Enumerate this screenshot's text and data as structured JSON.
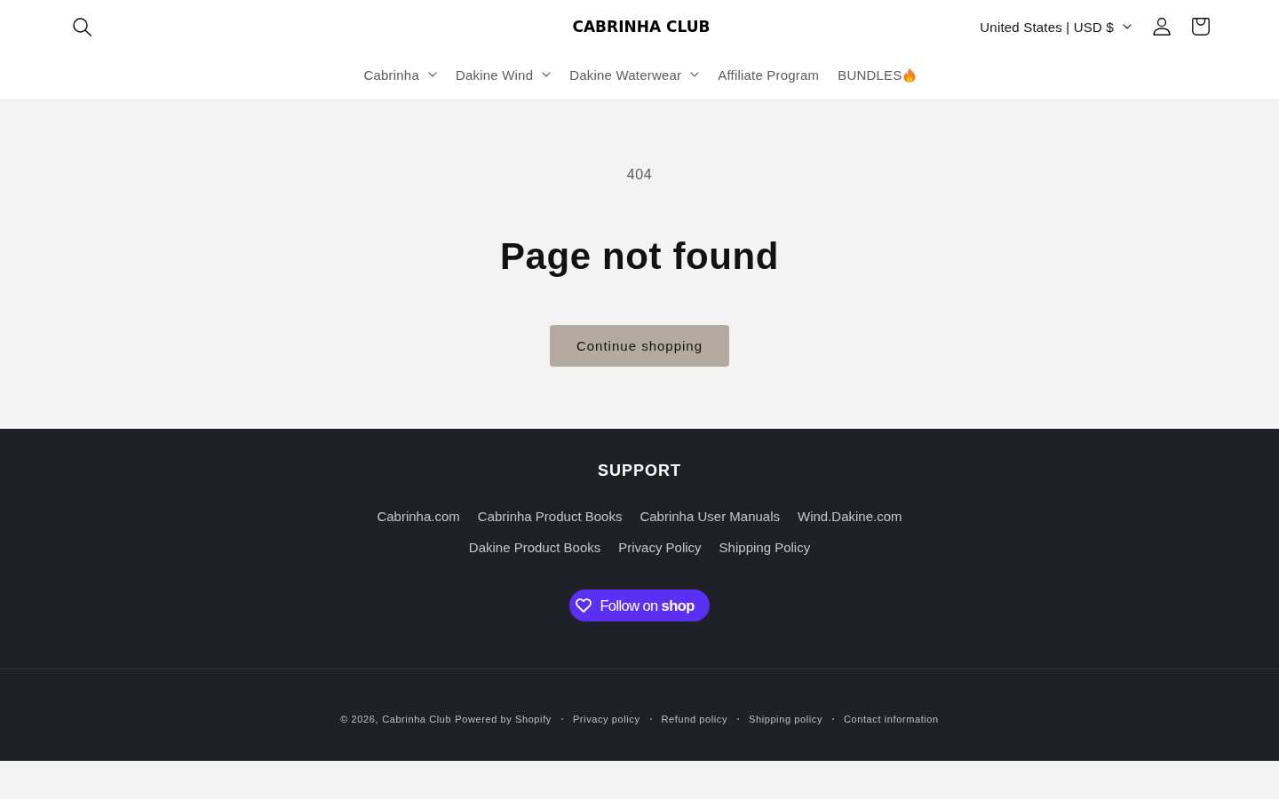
{
  "header": {
    "logo": "CABRINHA CLUB",
    "localization": "United States | USD $",
    "nav": [
      {
        "label": "Cabrinha",
        "kind": "menu"
      },
      {
        "label": "Dakine Wind",
        "kind": "menu"
      },
      {
        "label": "Dakine Waterwear",
        "kind": "menu"
      },
      {
        "label": "Affiliate Program",
        "kind": "link"
      },
      {
        "label": "BUNDLES",
        "kind": "promo"
      }
    ]
  },
  "main": {
    "code": "404",
    "title": "Page not found",
    "button": "Continue shopping"
  },
  "footer": {
    "heading": "SUPPORT",
    "links": [
      "Cabrinha.com",
      "Cabrinha Product Books",
      "Cabrinha User Manuals",
      "Wind.Dakine.com",
      "Dakine Product Books",
      "Privacy Policy",
      "Shipping Policy"
    ],
    "follow_button": "Follow on **shop**",
    "copyright": "© 2026,",
    "store_name": "Cabrinha Club",
    "powered_by": "Powered by Shopify",
    "policies": [
      "Privacy policy",
      "Refund policy",
      "Shipping policy",
      "Contact information"
    ]
  }
}
